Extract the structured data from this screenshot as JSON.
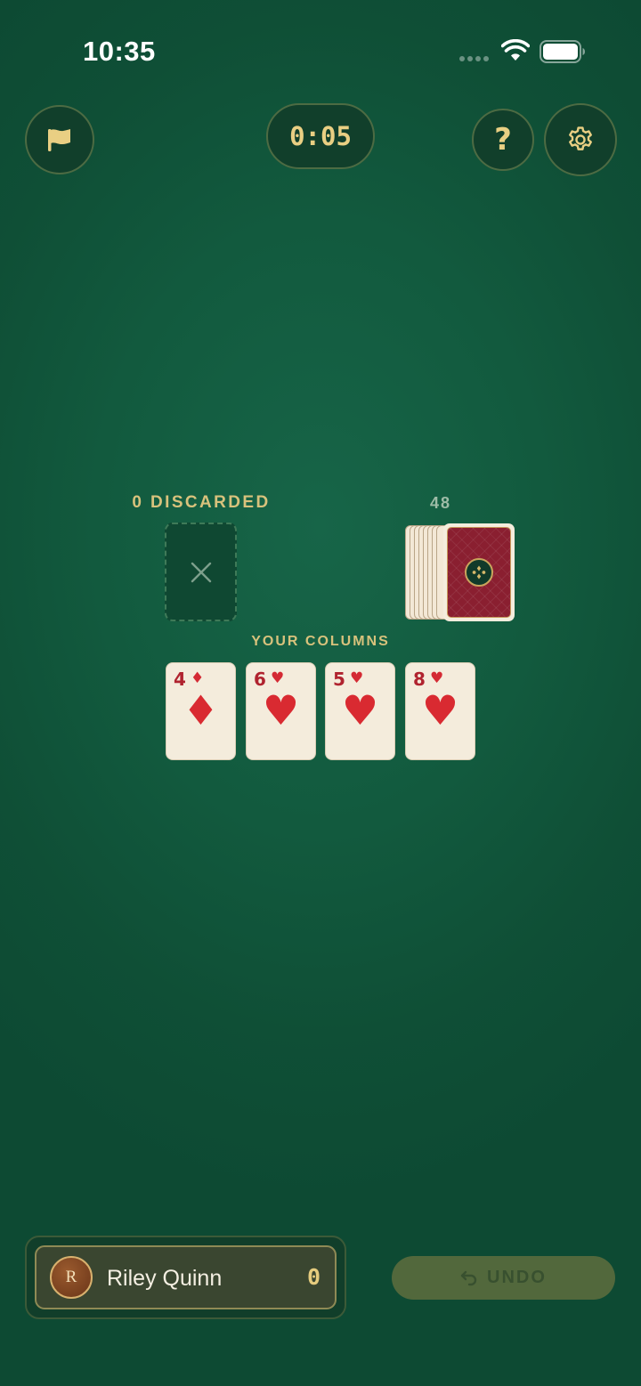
{
  "status_bar": {
    "time": "10:35"
  },
  "top_bar": {
    "timer": "0:05",
    "help_label": "?"
  },
  "table": {
    "discard_label": "0 DISCARDED",
    "deck_count": "48",
    "columns_label": "YOUR COLUMNS",
    "columns": [
      {
        "rank": "4",
        "suit": "♦",
        "suit_name": "diamonds"
      },
      {
        "rank": "6",
        "suit": "♥",
        "suit_name": "hearts"
      },
      {
        "rank": "5",
        "suit": "♥",
        "suit_name": "hearts"
      },
      {
        "rank": "8",
        "suit": "♥",
        "suit_name": "hearts"
      }
    ]
  },
  "player": {
    "initial": "R",
    "name": "Riley Quinn",
    "score": "0"
  },
  "undo": {
    "label": "UNDO",
    "enabled": false
  },
  "colors": {
    "felt": "#125a3e",
    "gold": "#e9cf83",
    "card_red": "#d92a31",
    "deck_back": "#8a1f30"
  },
  "icons": [
    "flag-icon",
    "help-icon",
    "gear-icon",
    "close-icon",
    "undo-icon",
    "wifi-icon",
    "battery-icon"
  ]
}
